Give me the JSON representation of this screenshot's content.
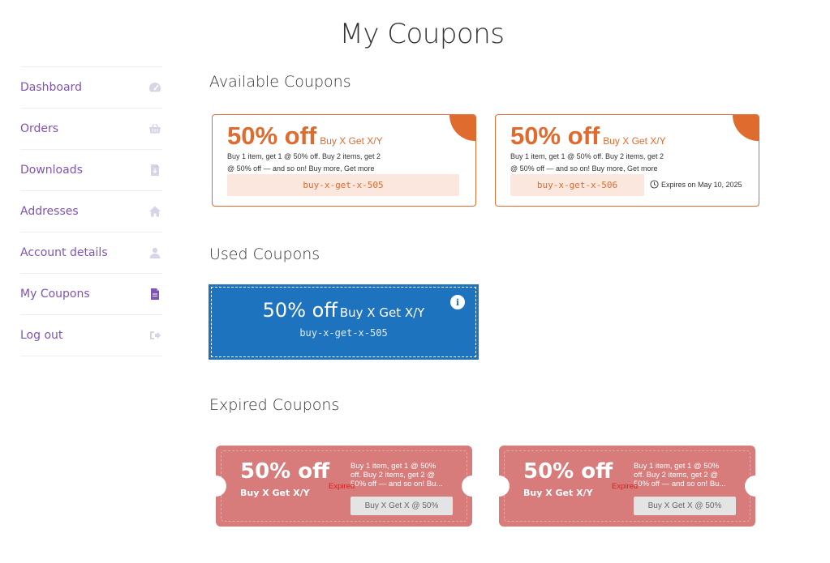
{
  "page": {
    "title": "My Coupons"
  },
  "colors": {
    "accent": "#7f54b3",
    "available": "#e06b2f",
    "used": "#1e73be",
    "expired": "#d77b7b"
  },
  "sidebar": {
    "items": [
      {
        "label": "Dashboard",
        "icon": "gauge-icon"
      },
      {
        "label": "Orders",
        "icon": "basket-icon"
      },
      {
        "label": "Downloads",
        "icon": "file-download-icon"
      },
      {
        "label": "Addresses",
        "icon": "home-icon"
      },
      {
        "label": "Account details",
        "icon": "user-icon"
      },
      {
        "label": "My Coupons",
        "icon": "document-icon"
      },
      {
        "label": "Log out",
        "icon": "sign-out-icon"
      }
    ]
  },
  "sections": {
    "available": "Available Coupons",
    "used": "Used Coupons",
    "expired": "Expired Coupons"
  },
  "available_coupons": [
    {
      "amount": "50% off",
      "type": "Buy X Get X/Y",
      "desc_line1": "Buy 1 item, get 1 @ 50% off. Buy 2 items, get 2",
      "desc_line2": "@ 50% off — and so on! Buy more, Get more",
      "code": "buy-x-get-x-505",
      "expiry": ""
    },
    {
      "amount": "50% off",
      "type": "Buy X Get X/Y",
      "desc_line1": "Buy 1 item, get 1 @ 50% off. Buy 2 items, get 2",
      "desc_line2": "@ 50% off — and so on! Buy more, Get more",
      "code": "buy-x-get-x-506",
      "expiry": "Expires on May 10, 2025"
    }
  ],
  "used_coupons": [
    {
      "amount": "50% off",
      "type": "Buy X Get X/Y",
      "code": "buy-x-get-x-505",
      "info": "i"
    }
  ],
  "expired_coupons": [
    {
      "amount": "50% off",
      "type": "Buy X Get X/Y",
      "desc_line1": "Buy 1 item, get 1 @ 50%",
      "desc_line2": "off. Buy 2 items, get 2 @",
      "desc_line3": "50% off — and so on! Bu...",
      "label": "Expired",
      "button": "Buy X Get X @ 50%"
    },
    {
      "amount": "50% off",
      "type": "Buy X Get X/Y",
      "desc_line1": "Buy 1 item, get 1 @ 50%",
      "desc_line2": "off. Buy 2 items, get 2 @",
      "desc_line3": "50% off — and so on! Bu...",
      "label": "Expired",
      "button": "Buy X Get X @ 50%"
    }
  ]
}
